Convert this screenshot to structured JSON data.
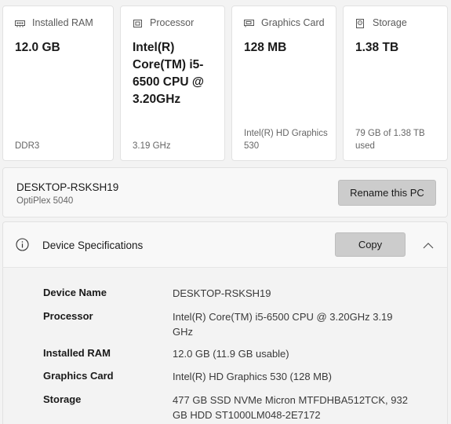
{
  "cards": [
    {
      "title": "Installed RAM",
      "icon": "ram-icon",
      "value": "12.0 GB",
      "sub": "DDR3"
    },
    {
      "title": "Processor",
      "icon": "processor-icon",
      "value": "Intel(R) Core(TM) i5-6500 CPU @ 3.20GHz",
      "sub": "3.19 GHz"
    },
    {
      "title": "Graphics Card",
      "icon": "graphics-card-icon",
      "value": "128 MB",
      "sub": "Intel(R) HD Graphics 530"
    },
    {
      "title": "Storage",
      "icon": "storage-icon",
      "value": "1.38 TB",
      "sub": "79 GB of 1.38 TB used"
    }
  ],
  "pc": {
    "name": "DESKTOP-RSKSH19",
    "model": "OptiPlex 5040",
    "rename_label": "Rename this PC"
  },
  "specs": {
    "title": "Device Specifications",
    "copy_label": "Copy",
    "rows": [
      {
        "label": "Device Name",
        "value": "DESKTOP-RSKSH19"
      },
      {
        "label": "Processor",
        "value": "Intel(R) Core(TM) i5-6500 CPU @ 3.20GHz   3.19 GHz"
      },
      {
        "label": "Installed RAM",
        "value": "12.0 GB (11.9 GB usable)"
      },
      {
        "label": "Graphics Card",
        "value": "Intel(R) HD Graphics 530 (128 MB)"
      },
      {
        "label": "Storage",
        "value": "477 GB SSD NVMe Micron MTFDHBA512TCK, 932 GB HDD ST1000LM048-2E7172"
      }
    ]
  },
  "colors": {
    "background": "#f3f3f3",
    "card": "#ffffff",
    "button": "#cccccc"
  }
}
